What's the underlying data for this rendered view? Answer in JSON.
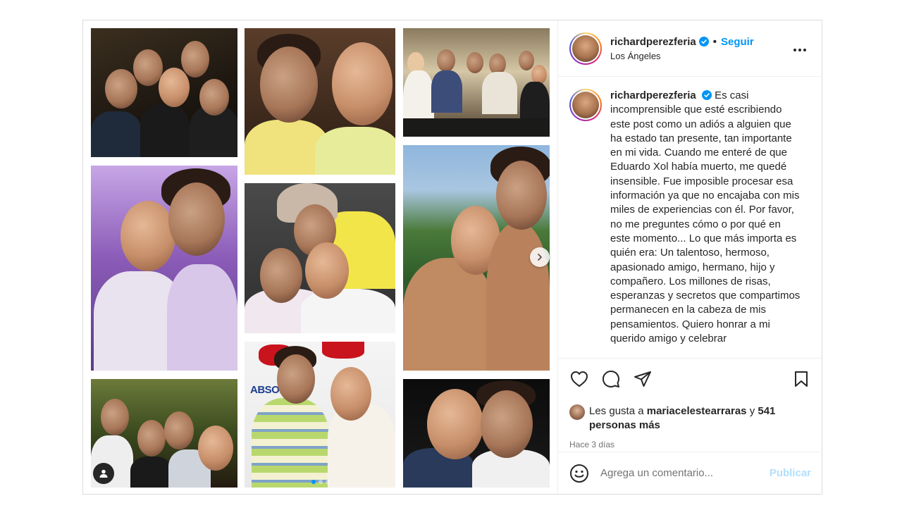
{
  "post": {
    "username": "richardperezferia",
    "follow_label": "Seguir",
    "separator": "•",
    "location": "Los Ángeles",
    "caption": "Es casi incomprensible que esté escribiendo este post como un adiós a alguien que ha estado tan presente, tan importante en mi vida. Cuando me enteré de que Eduardo Xol había muerto, me quedé insensible. Fue imposible procesar esa información ya que no encajaba con mis miles de experiencias con él. Por favor, no me preguntes cómo o por qué en este momento... Lo que más importa es quién era: Un talentoso, hermoso, apasionado amigo, hermano, hijo y compañero. Los millones de risas, esperanzas y secretos que compartimos permanecen en la cabeza de mis pensamientos. Quiero honrar a mi querido amigo y celebrar",
    "likes_prefix": "Les gusta a",
    "likes_user": "mariacelestearraras",
    "likes_connector": "y",
    "likes_count": "541",
    "likes_suffix": "personas más",
    "time_ago": "Hace 3 días",
    "comment_placeholder": "Agrega un comentario...",
    "publish_label": "Publicar",
    "carousel_total": 3,
    "carousel_active": 1
  },
  "photos": [
    {
      "name": "photo-group-bar"
    },
    {
      "name": "photo-two-men-yellow-shirts"
    },
    {
      "name": "photo-group-couch"
    },
    {
      "name": "photo-two-men-purple-light"
    },
    {
      "name": "photo-cap-kiss"
    },
    {
      "name": "photo-shirtless-outdoors"
    },
    {
      "name": "photo-four-friends"
    },
    {
      "name": "photo-absolut-event"
    },
    {
      "name": "photo-two-men-night"
    }
  ],
  "colors": {
    "link_blue": "#0095f6",
    "publish_disabled": "#b2dffc",
    "muted_text": "#737373",
    "border": "#dbdbdb"
  },
  "icons": [
    "verified-badge-icon",
    "more-options-icon",
    "heart-icon",
    "comment-icon",
    "share-icon",
    "bookmark-icon",
    "emoji-icon",
    "chevron-right-icon",
    "user-tag-icon"
  ]
}
